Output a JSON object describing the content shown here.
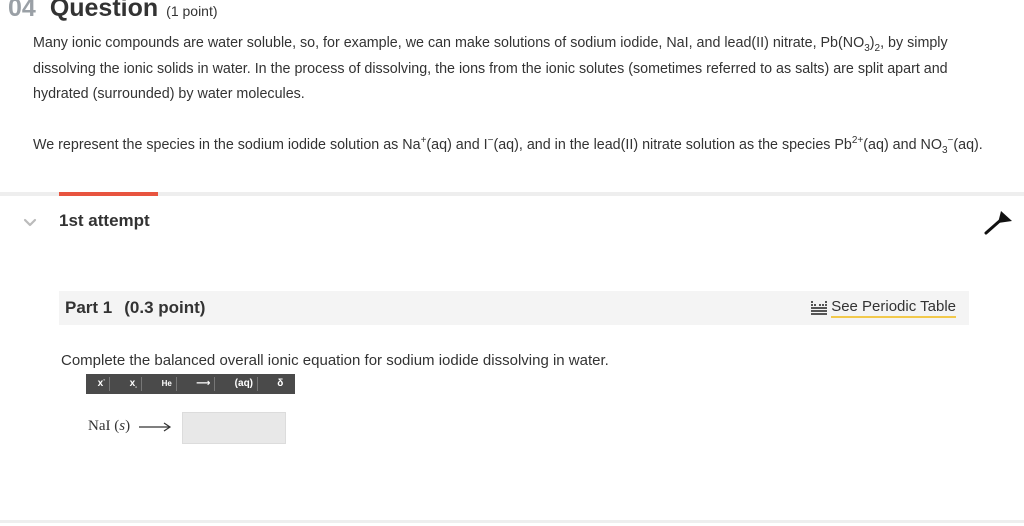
{
  "question": {
    "number": "04",
    "title": "Question",
    "points": "(1 point)"
  },
  "intro": {
    "p1": {
      "a": "Many ionic compounds are water soluble, so, for example, we can make solutions of sodium iodide, NaI, and lead(II) nitrate, Pb(NO",
      "sub1": "3",
      "b": ")",
      "sub2": "2",
      "c": ", by simply dissolving the ionic solids in water. In the process of dissolving, the ions from the ionic solutes (sometimes referred to as salts) are split apart and hydrated (surrounded) by water molecules."
    },
    "p2": {
      "a": "We represent the species in the sodium iodide solution as Na",
      "sup1": "+",
      "b": "(aq) and I",
      "sup2": "−",
      "c": "(aq), and in the lead(II) nitrate solution as the species Pb",
      "sup3": "2+",
      "d": "(aq) and NO",
      "sub1": "3",
      "sup4": "−",
      "e": "(aq)."
    }
  },
  "attempt": {
    "label": "1st attempt",
    "accent_color": "#e8543f"
  },
  "part": {
    "label": "Part 1",
    "points": "(0.3 point)",
    "periodic_link": "See Periodic Table"
  },
  "instruction": "Complete the balanced overall ionic equation for sodium iodide dissolving in water.",
  "toolbar": {
    "superscript": "x",
    "subscript": "x",
    "element": "He",
    "arrow": "⟶",
    "aq": "(aq)",
    "delta": "δ"
  },
  "equation": {
    "reactant": "NaI",
    "state": "s",
    "answer_value": ""
  },
  "icons": {
    "chevron": "chevron-down-icon",
    "pin": "pin-icon",
    "periodic": "periodic-table-icon"
  }
}
